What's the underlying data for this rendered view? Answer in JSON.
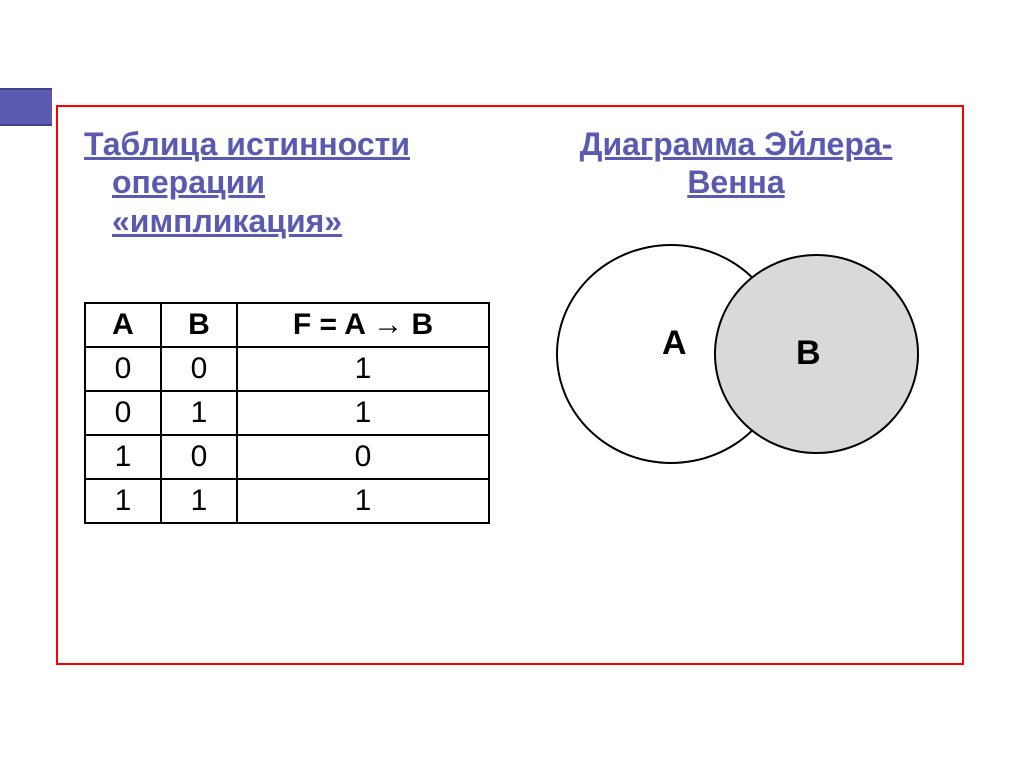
{
  "left": {
    "heading_line1": "Таблица истинности",
    "heading_line2": "операции ",
    "heading_line3": "«импликация»",
    "table": {
      "headers": {
        "a": "A",
        "b": "B",
        "f": "F = A → B"
      },
      "rows": [
        {
          "a": "0",
          "b": "0",
          "f": "1"
        },
        {
          "a": "0",
          "b": "1",
          "f": "1"
        },
        {
          "a": "1",
          "b": "0",
          "f": "0"
        },
        {
          "a": "1",
          "b": "1",
          "f": "1"
        }
      ]
    }
  },
  "right": {
    "heading_line1": "Диаграмма Эйлера-",
    "heading_line2": "Венна",
    "venn": {
      "label_a": "A",
      "label_b": "B"
    }
  }
}
